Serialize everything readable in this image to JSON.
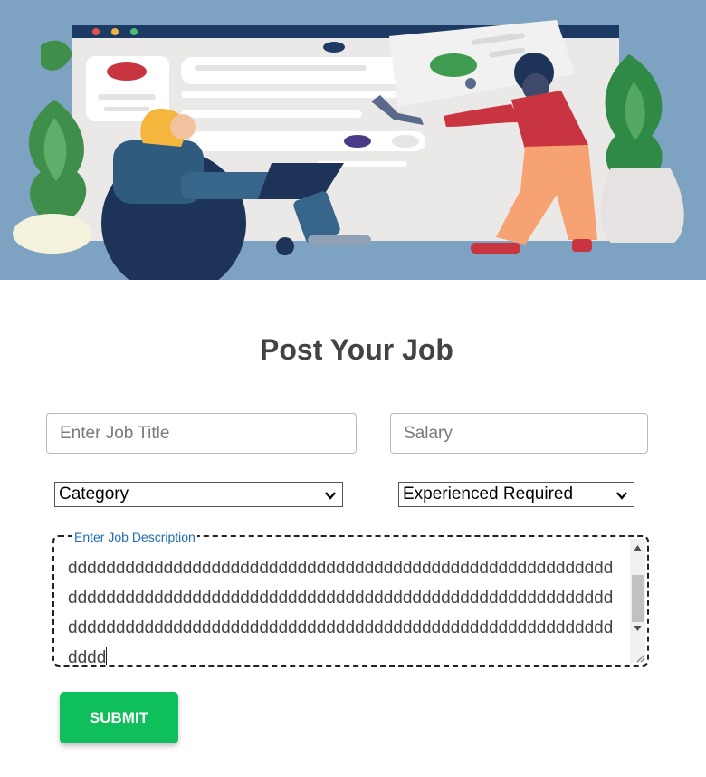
{
  "header": {
    "title": "Post Your Job"
  },
  "form": {
    "job_title": {
      "placeholder": "Enter Job Title",
      "value": ""
    },
    "salary": {
      "placeholder": "Salary",
      "value": ""
    },
    "category": {
      "selected": "Category"
    },
    "experience": {
      "selected": "Experienced Required"
    },
    "description": {
      "label": "Enter Job Description",
      "value": "ddddddddddddddddddddddddddddddddddddddddddddddddddddddddddddddddddddddddddddddddddddddddddddddddddddddddddddddddddddddddddddddddddddddddddddddddddddddddddddddddddddddddddddddd"
    },
    "submit_label": "SUBMIT"
  },
  "colors": {
    "hero_background": "#7ea3c2",
    "submit_green": "#0fbf5b",
    "label_blue": "#1f6bb6",
    "title_text": "#434343"
  }
}
